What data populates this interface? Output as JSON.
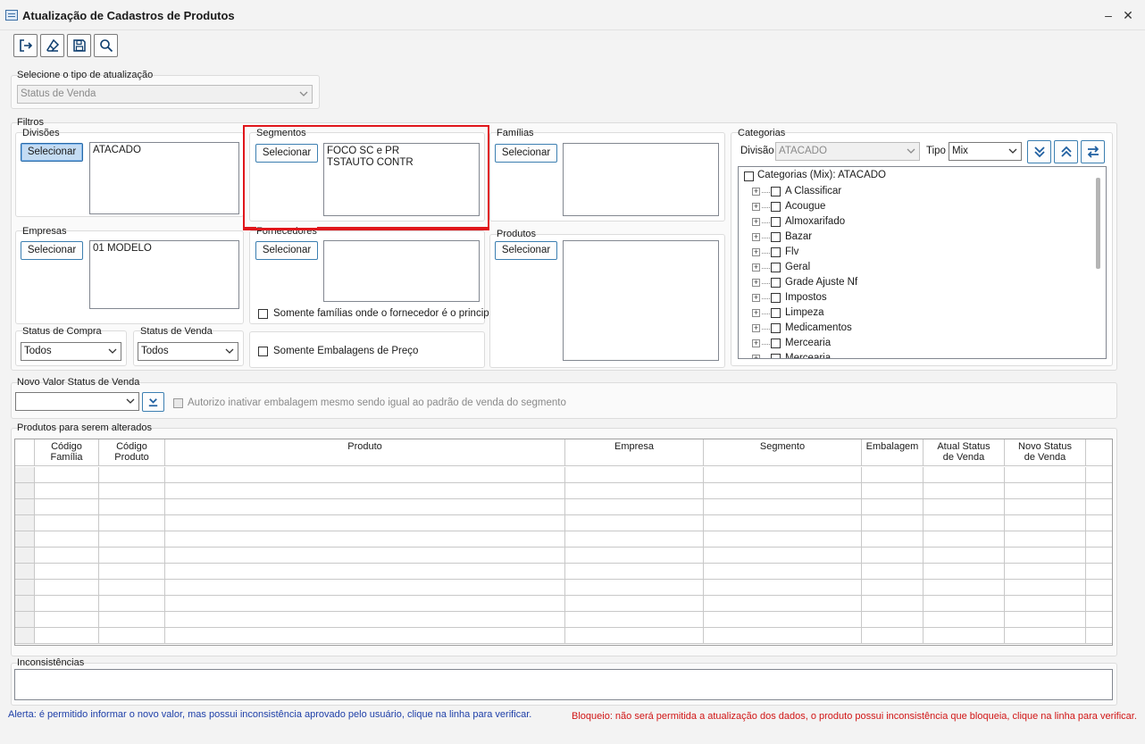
{
  "window": {
    "title": "Atualização de Cadastros de Produtos"
  },
  "toolbar": [
    {
      "name": "exit-button",
      "icon": "exit-icon"
    },
    {
      "name": "clear-button",
      "icon": "eraser-icon"
    },
    {
      "name": "save-button",
      "icon": "save-icon"
    },
    {
      "name": "search-button",
      "icon": "search-icon"
    }
  ],
  "update_type": {
    "label": "Selecione o tipo de atualização",
    "value": "Status de Venda"
  },
  "filters": {
    "label": "Filtros",
    "divisoes": {
      "label": "Divisões",
      "button": "Selecionar",
      "items": "ATACADO"
    },
    "segmentos": {
      "label": "Segmentos",
      "button": "Selecionar",
      "items": "FOCO SC e PR\nTSTAUTO CONTR"
    },
    "familias": {
      "label": "Famílias",
      "button": "Selecionar",
      "items": ""
    },
    "empresas": {
      "label": "Empresas",
      "button": "Selecionar",
      "items": "01 MODELO"
    },
    "fornecedores": {
      "label": "Fornecedores",
      "button": "Selecionar",
      "items": "",
      "checkbox": "Somente famílias onde o fornecedor é o principal"
    },
    "produtos": {
      "label": "Produtos",
      "button": "Selecionar",
      "items": ""
    },
    "status_compra": {
      "label": "Status de Compra",
      "value": "Todos"
    },
    "status_venda": {
      "label": "Status de Venda",
      "value": "Todos"
    },
    "embalagens": {
      "checkbox": "Somente Embalagens de Preço"
    }
  },
  "categorias": {
    "label": "Categorias",
    "divisao_label": "Divisão",
    "divisao_value": "ATACADO",
    "tipo_label": "Tipo",
    "tipo_value": "Mix",
    "root": "Categorias (Mix): ATACADO",
    "items": [
      "A Classificar",
      "Acougue",
      "Almoxarifado",
      "Bazar",
      "Flv",
      "Geral",
      "Grade Ajuste Nf",
      "Impostos",
      "Limpeza",
      "Medicamentos",
      "Mercearia",
      "Mercearia"
    ]
  },
  "novo_valor": {
    "label": "Novo Valor Status de Venda",
    "value": "",
    "checkbox": "Autorizo inativar embalagem mesmo sendo igual ao padrão de venda do segmento"
  },
  "grid": {
    "label": "Produtos para serem alterados",
    "columns": [
      "Código\nFamília",
      "Código\nProduto",
      "Produto",
      "Empresa",
      "Segmento",
      "Embalagem",
      "Atual Status\nde Venda",
      "Novo Status\nde Venda"
    ],
    "row_count": 11
  },
  "inconsistencias": {
    "label": "Inconsistências",
    "alert": "Alerta: é permitido informar o novo valor, mas possui inconsistência aprovado pelo usuário, clique na linha para verificar.",
    "block": "Bloqueio: não será permitida a atualização dos dados, o produto possui inconsistência que bloqueia, clique na linha para verificar."
  },
  "colors": {
    "highlight": "#e0161b",
    "alert": "#1e3fa8",
    "block": "#d11515",
    "button_border": "#3c7fb1"
  }
}
